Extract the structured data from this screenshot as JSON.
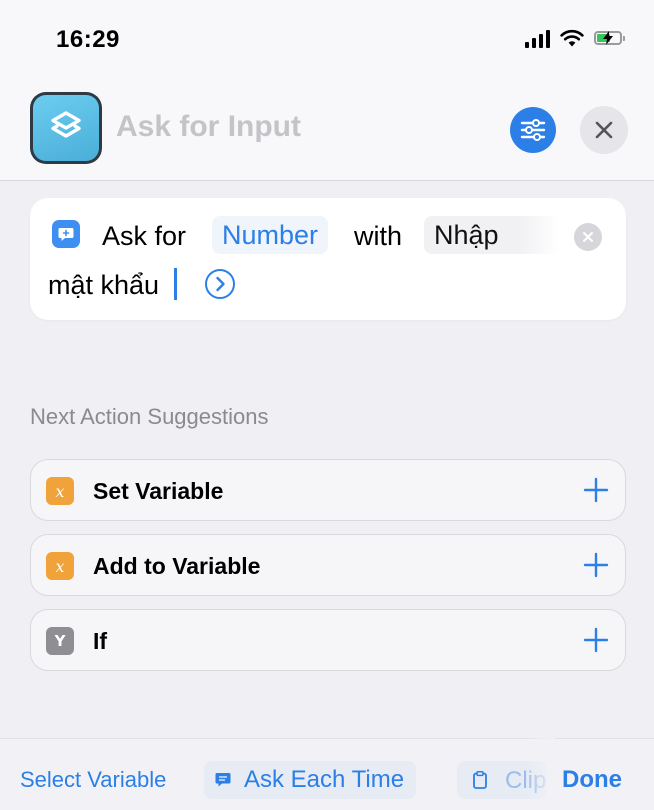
{
  "status_bar": {
    "time": "16:29",
    "battery_level": 0.6,
    "battery_charging": true
  },
  "nav": {
    "title": "Ask for Input",
    "app_icon": "shortcuts-layers-icon",
    "settings_icon": "sliders-icon",
    "close_icon": "close-icon"
  },
  "action": {
    "prefix": "Ask for",
    "input_type": "Number",
    "connector": "with",
    "prompt_line1": "Nhập",
    "prompt_line2": "mật khẩu",
    "icon": "speech-bubble-icon"
  },
  "suggestions": {
    "title": "Next Action Suggestions",
    "items": [
      {
        "label": "Set Variable",
        "icon": "x",
        "color": "#f0a33a"
      },
      {
        "label": "Add to Variable",
        "icon": "x",
        "color": "#f0a33a"
      },
      {
        "label": "If",
        "icon": "Y",
        "color": "#8e8e93"
      }
    ]
  },
  "toolbar": {
    "select_variable": "Select Variable",
    "ask_each_time": "Ask Each Time",
    "clipboard": "Clipboard",
    "done": "Done"
  },
  "colors": {
    "accent": "#2b7fe6",
    "variable_orange": "#f0a33a",
    "scripting_gray": "#8e8e93",
    "app_icon_blue": "#5bbfe6"
  }
}
